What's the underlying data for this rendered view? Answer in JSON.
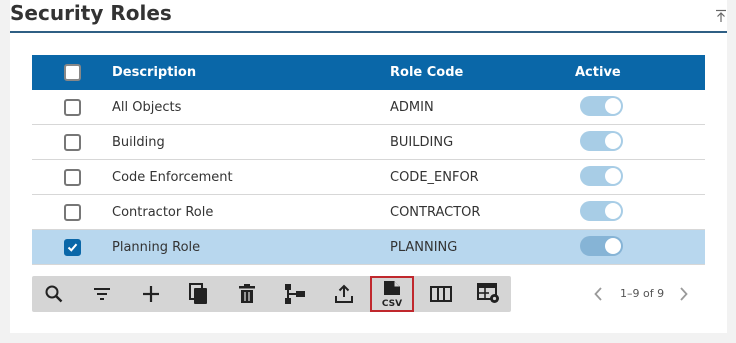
{
  "page": {
    "title": "Security Roles"
  },
  "table": {
    "columns": {
      "description": "Description",
      "role_code": "Role Code",
      "active": "Active"
    },
    "rows": [
      {
        "description": "All Objects",
        "role_code": "ADMIN",
        "active": true,
        "selected": false
      },
      {
        "description": "Building",
        "role_code": "BUILDING",
        "active": true,
        "selected": false
      },
      {
        "description": "Code Enforcement",
        "role_code": "CODE_ENFOR",
        "active": true,
        "selected": false
      },
      {
        "description": "Contractor Role",
        "role_code": "CONTRACTOR",
        "active": true,
        "selected": false
      },
      {
        "description": "Planning Role",
        "role_code": "PLANNING",
        "active": true,
        "selected": true
      }
    ]
  },
  "toolbar": {
    "tools": [
      "search-icon",
      "filter-icon",
      "add-icon",
      "copy-icon",
      "delete-icon",
      "hierarchy-icon",
      "export-icon",
      "csv-export-icon",
      "columns-icon",
      "table-settings-icon"
    ],
    "csv_label": "CSV"
  },
  "pager": {
    "count": "1–9 of 9"
  },
  "colors": {
    "header": "#0a67a8",
    "selected_row": "#b8d7ee",
    "active_tool_border": "#c0282d",
    "toggle_on": "#a8cde6"
  }
}
